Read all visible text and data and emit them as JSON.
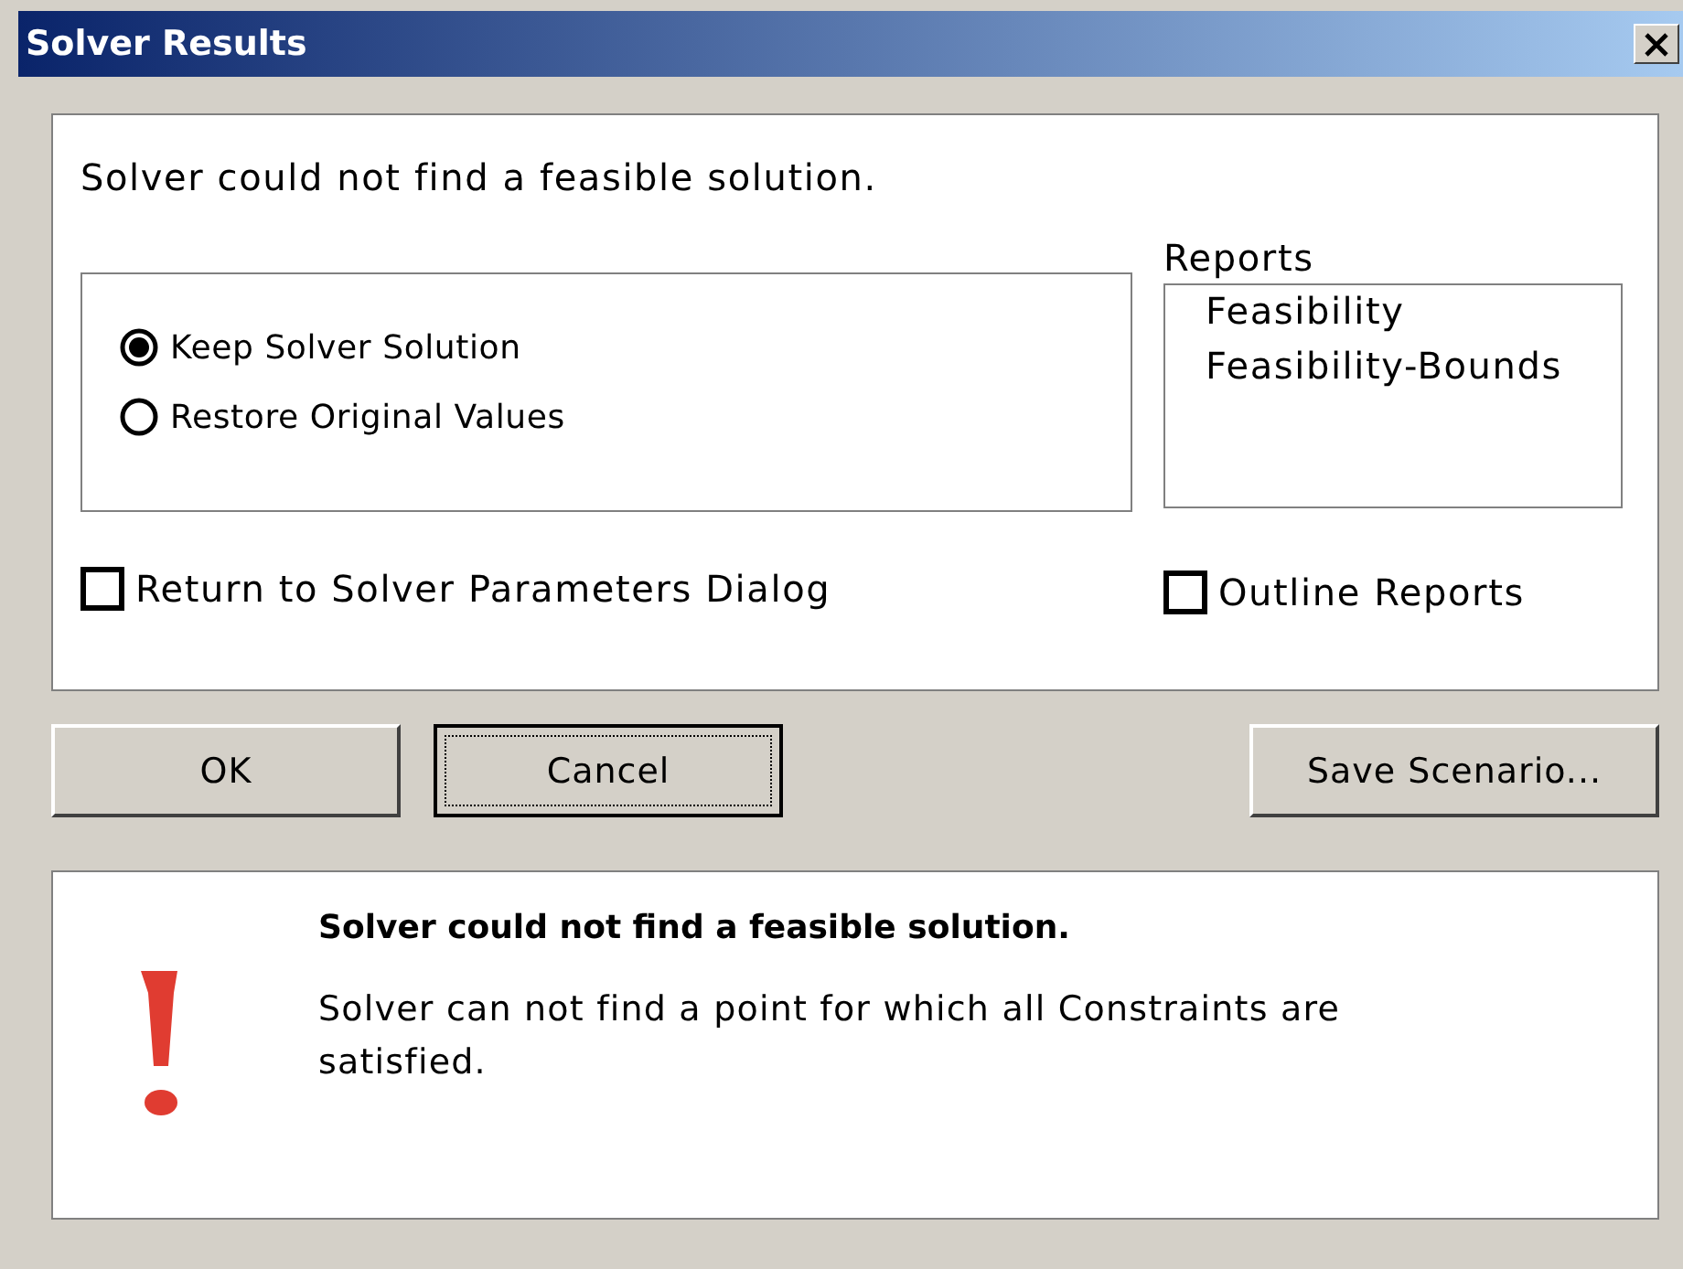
{
  "window": {
    "title": "Solver Results"
  },
  "message": "Solver could not find a feasible solution.",
  "options": [
    {
      "label": "Keep Solver Solution",
      "selected": true
    },
    {
      "label": "Restore Original Values",
      "selected": false
    }
  ],
  "return_dialog": {
    "label": "Return to Solver Parameters Dialog",
    "checked": false
  },
  "reports": {
    "label": "Reports",
    "items": [
      {
        "label": "Feasibility",
        "selected": false
      },
      {
        "label": "Feasibility-Bounds",
        "selected": false
      }
    ]
  },
  "outline_reports": {
    "label": "Outline Reports",
    "checked": false
  },
  "buttons": [
    {
      "label": "OK",
      "focused": false
    },
    {
      "label": "Cancel",
      "focused": true
    },
    {
      "label": "Save Scenario...",
      "focused": false
    }
  ],
  "status": {
    "kind": "error",
    "title": "Solver could not find a feasible solution.",
    "detail": "Solver can not find a point for which all Constraints are satisfied."
  }
}
